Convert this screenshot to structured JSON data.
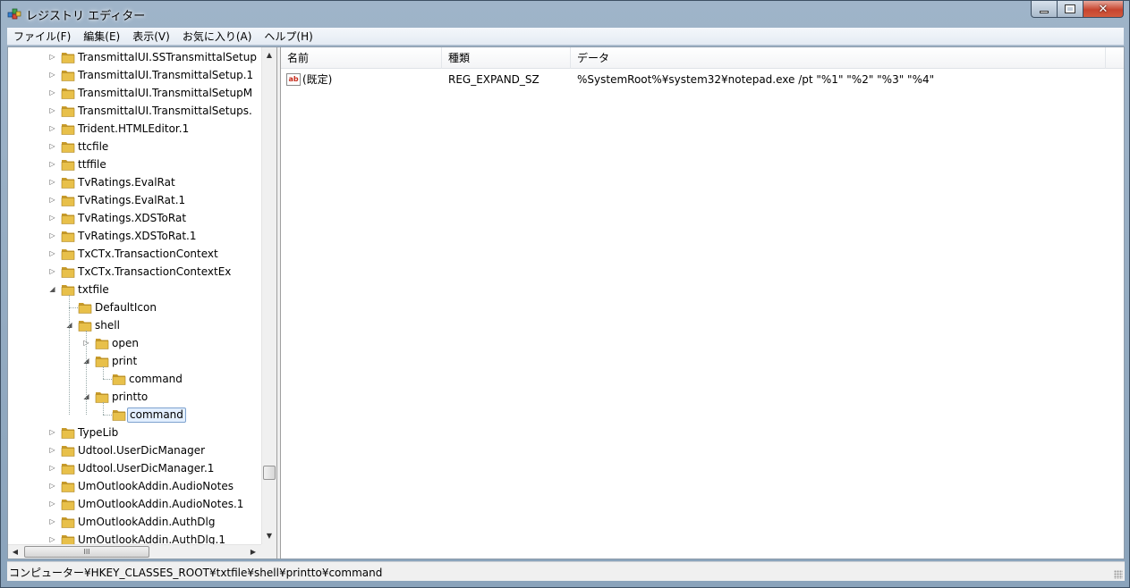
{
  "window": {
    "title": "レジストリ エディター"
  },
  "menu": [
    "ファイル(F)",
    "編集(E)",
    "表示(V)",
    "お気に入り(A)",
    "ヘルプ(H)"
  ],
  "tree": [
    {
      "label": "TransmittalUI.SSTransmittalSetup",
      "level": 0,
      "expander": "collapsed"
    },
    {
      "label": "TransmittalUI.TransmittalSetup.1",
      "level": 0,
      "expander": "collapsed"
    },
    {
      "label": "TransmittalUI.TransmittalSetupM",
      "level": 0,
      "expander": "collapsed"
    },
    {
      "label": "TransmittalUI.TransmittalSetups.",
      "level": 0,
      "expander": "collapsed"
    },
    {
      "label": "Trident.HTMLEditor.1",
      "level": 0,
      "expander": "collapsed"
    },
    {
      "label": "ttcfile",
      "level": 0,
      "expander": "collapsed"
    },
    {
      "label": "ttffile",
      "level": 0,
      "expander": "collapsed"
    },
    {
      "label": "TvRatings.EvalRat",
      "level": 0,
      "expander": "collapsed"
    },
    {
      "label": "TvRatings.EvalRat.1",
      "level": 0,
      "expander": "collapsed"
    },
    {
      "label": "TvRatings.XDSToRat",
      "level": 0,
      "expander": "collapsed"
    },
    {
      "label": "TvRatings.XDSToRat.1",
      "level": 0,
      "expander": "collapsed"
    },
    {
      "label": "TxCTx.TransactionContext",
      "level": 0,
      "expander": "collapsed"
    },
    {
      "label": "TxCTx.TransactionContextEx",
      "level": 0,
      "expander": "collapsed"
    },
    {
      "label": "txtfile",
      "level": 0,
      "expander": "expanded"
    },
    {
      "label": "DefaultIcon",
      "level": 1,
      "expander": "none"
    },
    {
      "label": "shell",
      "level": 1,
      "expander": "expanded"
    },
    {
      "label": "open",
      "level": 2,
      "expander": "collapsed"
    },
    {
      "label": "print",
      "level": 2,
      "expander": "expanded"
    },
    {
      "label": "command",
      "level": 3,
      "expander": "none"
    },
    {
      "label": "printto",
      "level": 2,
      "expander": "expanded"
    },
    {
      "label": "command",
      "level": 3,
      "expander": "none",
      "selected": true
    },
    {
      "label": "TypeLib",
      "level": 0,
      "expander": "collapsed"
    },
    {
      "label": "Udtool.UserDicManager",
      "level": 0,
      "expander": "collapsed"
    },
    {
      "label": "Udtool.UserDicManager.1",
      "level": 0,
      "expander": "collapsed"
    },
    {
      "label": "UmOutlookAddin.AudioNotes",
      "level": 0,
      "expander": "collapsed"
    },
    {
      "label": "UmOutlookAddin.AudioNotes.1",
      "level": 0,
      "expander": "collapsed"
    },
    {
      "label": "UmOutlookAddin.AuthDlg",
      "level": 0,
      "expander": "collapsed"
    },
    {
      "label": "UmOutlookAddin.AuthDlg.1",
      "level": 0,
      "expander": "collapsed"
    }
  ],
  "hscroll_thumb_label": "III",
  "list": {
    "columns": [
      "名前",
      "種類",
      "データ"
    ],
    "rows": [
      {
        "name": "(既定)",
        "type": "REG_EXPAND_SZ",
        "data": "%SystemRoot%¥system32¥notepad.exe /pt \"%1\" \"%2\" \"%3\" \"%4\"",
        "icon": "string-value-icon"
      }
    ]
  },
  "status": "コンピューター¥HKEY_CLASSES_ROOT¥txtfile¥shell¥printto¥command",
  "colors": {
    "folder": "#e8c04a",
    "selection_bg": "#e3efff",
    "selection_border": "#7da2ce"
  }
}
